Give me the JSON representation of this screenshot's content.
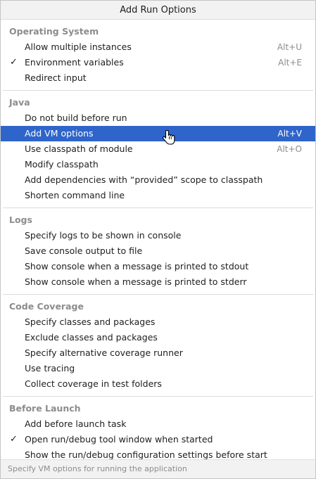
{
  "window": {
    "title": "Add Run Options"
  },
  "sections": [
    {
      "header": "Operating System",
      "items": [
        {
          "label": "Allow multiple instances",
          "shortcut": "Alt+U",
          "checked": false,
          "selected": false
        },
        {
          "label": "Environment variables",
          "shortcut": "Alt+E",
          "checked": true,
          "selected": false
        },
        {
          "label": "Redirect input",
          "shortcut": "",
          "checked": false,
          "selected": false
        }
      ]
    },
    {
      "header": "Java",
      "items": [
        {
          "label": "Do not build before run",
          "shortcut": "",
          "checked": false,
          "selected": false
        },
        {
          "label": "Add VM options",
          "shortcut": "Alt+V",
          "checked": false,
          "selected": true
        },
        {
          "label": "Use classpath of module",
          "shortcut": "Alt+O",
          "checked": false,
          "selected": false
        },
        {
          "label": "Modify classpath",
          "shortcut": "",
          "checked": false,
          "selected": false
        },
        {
          "label": "Add dependencies with “provided” scope to classpath",
          "shortcut": "",
          "checked": false,
          "selected": false
        },
        {
          "label": "Shorten command line",
          "shortcut": "",
          "checked": false,
          "selected": false
        }
      ]
    },
    {
      "header": "Logs",
      "items": [
        {
          "label": "Specify logs to be shown in console",
          "shortcut": "",
          "checked": false,
          "selected": false
        },
        {
          "label": "Save console output to file",
          "shortcut": "",
          "checked": false,
          "selected": false
        },
        {
          "label": "Show console when a message is printed to stdout",
          "shortcut": "",
          "checked": false,
          "selected": false
        },
        {
          "label": "Show console when a message is printed to stderr",
          "shortcut": "",
          "checked": false,
          "selected": false
        }
      ]
    },
    {
      "header": "Code Coverage",
      "items": [
        {
          "label": "Specify classes and packages",
          "shortcut": "",
          "checked": false,
          "selected": false
        },
        {
          "label": "Exclude classes and packages",
          "shortcut": "",
          "checked": false,
          "selected": false
        },
        {
          "label": "Specify alternative coverage runner",
          "shortcut": "",
          "checked": false,
          "selected": false
        },
        {
          "label": "Use tracing",
          "shortcut": "",
          "checked": false,
          "selected": false
        },
        {
          "label": "Collect coverage in test folders",
          "shortcut": "",
          "checked": false,
          "selected": false
        }
      ]
    },
    {
      "header": "Before Launch",
      "items": [
        {
          "label": "Add before launch task",
          "shortcut": "",
          "checked": false,
          "selected": false
        },
        {
          "label": "Open run/debug tool window when started",
          "shortcut": "",
          "checked": true,
          "selected": false
        },
        {
          "label": "Show the run/debug configuration settings before start",
          "shortcut": "",
          "checked": false,
          "selected": false
        }
      ]
    }
  ],
  "status": {
    "text": "Specify VM options for running the application"
  },
  "icons": {
    "check": "checkmark-icon",
    "cursor": "hand-pointer-cursor-icon"
  },
  "colors": {
    "selection": "#2f65ca",
    "section_header": "#8c8c8c",
    "shortcut": "#8c8c8c"
  }
}
